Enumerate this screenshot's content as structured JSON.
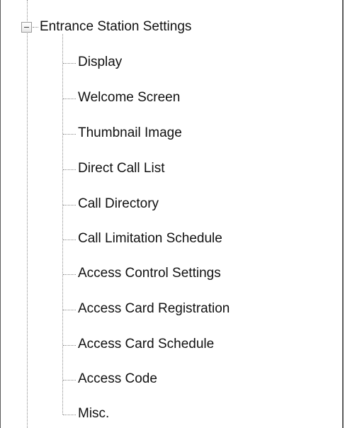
{
  "tree": {
    "root": {
      "label": "Entrance Station Settings",
      "expanded": true,
      "icon": "collapse-minus-icon"
    },
    "children": [
      {
        "label": "Display"
      },
      {
        "label": "Welcome Screen"
      },
      {
        "label": "Thumbnail Image"
      },
      {
        "label": "Direct Call List"
      },
      {
        "label": "Call Directory"
      },
      {
        "label": "Call Limitation Schedule"
      },
      {
        "label": "Access Control Settings"
      },
      {
        "label": "Access Card Registration"
      },
      {
        "label": "Access Card Schedule"
      },
      {
        "label": "Access Code"
      },
      {
        "label": "Misc."
      }
    ]
  }
}
